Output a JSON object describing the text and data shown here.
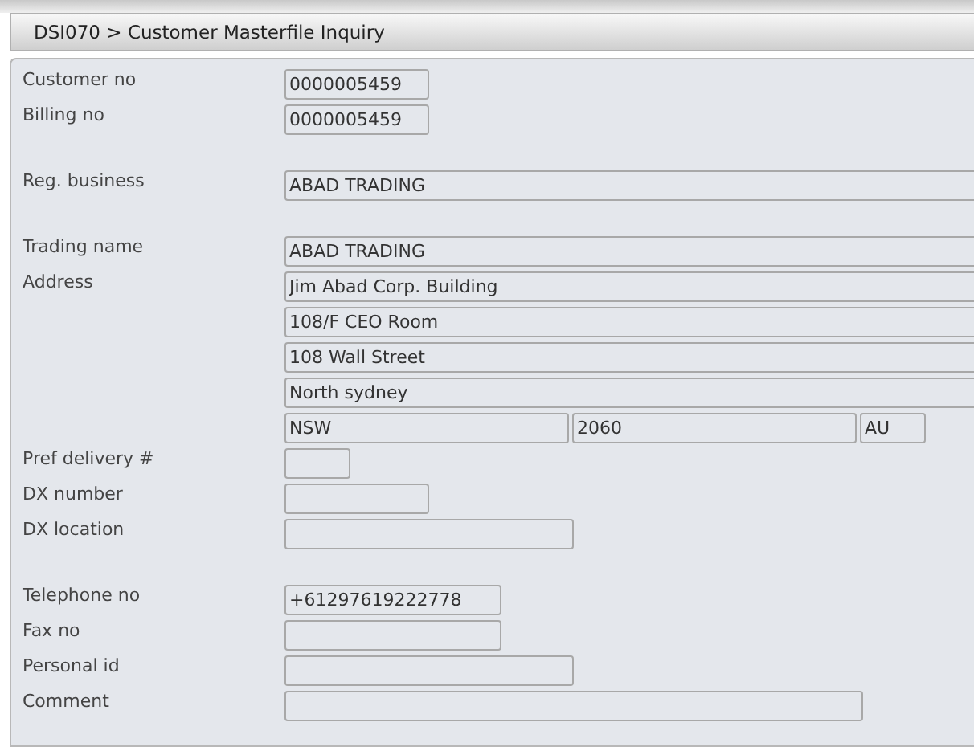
{
  "header": {
    "title": "DSI070 > Customer Masterfile Inquiry"
  },
  "sections": [
    {
      "rows": [
        {
          "label": "Customer no",
          "fields": [
            {
              "kind": "medium",
              "value": "0000005459"
            }
          ]
        },
        {
          "label": "Billing no",
          "fields": [
            {
              "kind": "medium",
              "value": "0000005459"
            }
          ]
        }
      ]
    },
    {
      "rows": [
        {
          "label": "Reg. business",
          "fields": [
            {
              "kind": "full",
              "value": "ABAD TRADING"
            }
          ]
        }
      ]
    },
    {
      "rows": [
        {
          "label": "Trading name",
          "fields": [
            {
              "kind": "full",
              "value": "ABAD TRADING"
            }
          ]
        },
        {
          "label": "Address",
          "fields": [
            {
              "kind": "full",
              "value": "Jim Abad Corp. Building"
            }
          ]
        },
        {
          "fields": [
            {
              "kind": "full",
              "value": "108/F CEO Room"
            }
          ]
        },
        {
          "fields": [
            {
              "kind": "full",
              "value": "108 Wall Street"
            }
          ]
        },
        {
          "fields": [
            {
              "kind": "full",
              "value": "North sydney"
            }
          ]
        },
        {
          "fields": [
            {
              "kind": "wide",
              "value": "NSW"
            },
            {
              "kind": "wide",
              "value": "2060"
            },
            {
              "kind": "tiny",
              "value": "AU"
            }
          ]
        },
        {
          "label": "Pref delivery #",
          "fields": [
            {
              "kind": "tiny"
            }
          ]
        },
        {
          "label": "DX number",
          "fields": [
            {
              "kind": "medium"
            }
          ]
        },
        {
          "label": "DX location",
          "fields": [
            {
              "kind": "large"
            }
          ]
        }
      ]
    },
    {
      "rows": [
        {
          "label": "Telephone no",
          "fields": [
            {
              "kind": "phone",
              "value": "+61297619222778"
            }
          ]
        },
        {
          "label": "Fax no",
          "fields": [
            {
              "kind": "phone"
            }
          ]
        },
        {
          "label": "Personal id",
          "fields": [
            {
              "kind": "large"
            }
          ]
        },
        {
          "label": "Comment",
          "fields": [
            {
              "kind": "huge"
            }
          ]
        }
      ]
    }
  ]
}
